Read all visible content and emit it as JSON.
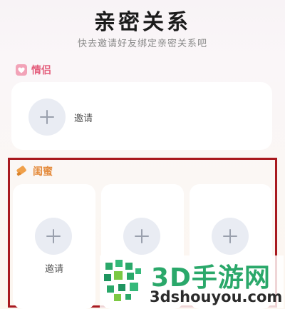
{
  "header": {
    "title": "亲密关系",
    "subtitle": "快去邀请好友绑定亲密关系吧"
  },
  "lovers": {
    "label": "情侣",
    "invite_label": "邀请",
    "icon": "heart-icon"
  },
  "friends": {
    "label": "闺蜜",
    "icon": "pencil-icon",
    "slots": [
      {
        "invite_label": "邀请"
      },
      {
        "invite_label": ""
      },
      {
        "invite_label": ""
      }
    ]
  },
  "watermark": {
    "brand": "3D手游网",
    "url": "3dshouyou.com"
  },
  "colors": {
    "lovers_accent": "#e4607e",
    "friends_accent": "#e48a3a",
    "highlight_border": "#a8191f",
    "watermark_green": "#2aa86a"
  }
}
